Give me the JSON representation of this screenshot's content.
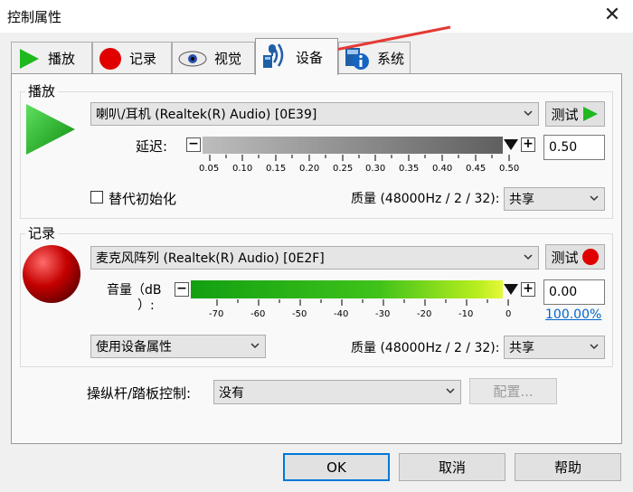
{
  "window": {
    "title": "控制属性"
  },
  "tabs": [
    {
      "label": "播放",
      "icon": "play-icon"
    },
    {
      "label": "记录",
      "icon": "record-icon"
    },
    {
      "label": "视觉",
      "icon": "eye-icon"
    },
    {
      "label": "设备",
      "icon": "device-icon"
    },
    {
      "label": "系统",
      "icon": "system-info-icon"
    }
  ],
  "playback": {
    "group_label": "播放",
    "device": "喇叭/耳机 (Realtek(R) Audio) [0E39]",
    "test_label": "测试",
    "delay_label": "延迟:",
    "delay_value": "0.50",
    "delay_level": 1.0,
    "ticks": [
      "0.05",
      "0.10",
      "0.15",
      "0.20",
      "0.25",
      "0.30",
      "0.35",
      "0.40",
      "0.45",
      "0.50"
    ],
    "substitute_label": "替代初始化",
    "quality_label": "质量 (48000Hz / 2 / 32):",
    "quality_value": "共享"
  },
  "record": {
    "group_label": "记录",
    "device": "麦克风阵列 (Realtek(R) Audio) [0E2F]",
    "test_label": "测试",
    "volume_label": "音量 (dB)",
    "volume_label_line1": "音量（dB",
    "volume_label_line2": "）:",
    "volume_value": "0.00",
    "volume_percent": "100.00%",
    "volume_level": 1.0,
    "ticks": [
      "-70",
      "-60",
      "-50",
      "-40",
      "-30",
      "-20",
      "-10",
      "0"
    ],
    "device_props": "使用设备属性",
    "quality_label": "质量 (48000Hz / 2 / 32):",
    "quality_value": "共享"
  },
  "joystick": {
    "label": "操纵杆/踏板控制:",
    "value": "没有",
    "config_label": "配置..."
  },
  "buttons": {
    "ok": "OK",
    "cancel": "取消",
    "help": "帮助"
  },
  "colors": {
    "play_green": "#1fb81f",
    "record_red": "#e00000",
    "selection_blue": "#0078d7",
    "annotation_red": "#e53935"
  }
}
